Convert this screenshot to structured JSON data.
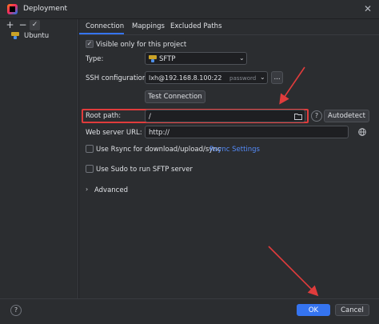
{
  "window": {
    "title": "Deployment"
  },
  "toolbar": {
    "add": "+",
    "remove": "−",
    "check": "✓"
  },
  "tree": {
    "items": [
      {
        "label": "Ubuntu"
      }
    ]
  },
  "tabs": [
    {
      "label": "Connection"
    },
    {
      "label": "Mappings"
    },
    {
      "label": "Excluded Paths"
    }
  ],
  "connection": {
    "visible_only": "Visible only for this project",
    "type_label": "Type:",
    "type_value": "SFTP",
    "ssh_label": "SSH configuration:",
    "ssh_value": "lxh@192.168.8.100:22",
    "ssh_auth": "password",
    "ssh_more": "...",
    "test_button": "Test Connection",
    "root_label": "Root path:",
    "root_value": "/",
    "autodetect_button": "Autodetect",
    "help_glyph": "?",
    "web_label": "Web server URL:",
    "web_value": "http://",
    "rsync_label": "Use Rsync for download/upload/sync",
    "rsync_link": "Rsync Settings",
    "sudo_label": "Use Sudo to run SFTP server",
    "advanced_label": "Advanced"
  },
  "footer": {
    "help": "?",
    "ok": "OK",
    "cancel": "Cancel"
  },
  "colors": {
    "accent": "#3574f0",
    "annotation": "#e03c3c",
    "link": "#548af7"
  }
}
